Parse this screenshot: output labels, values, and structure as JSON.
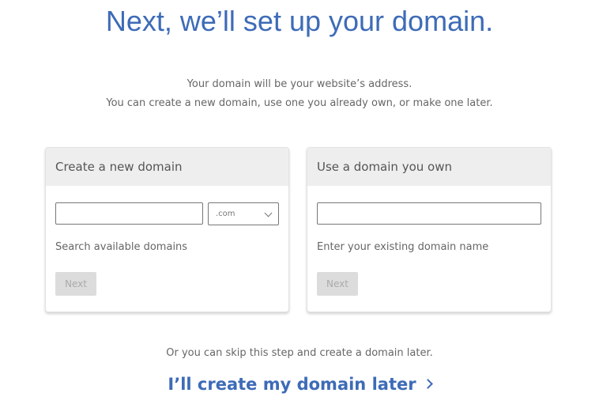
{
  "header": {
    "title": "Next, we’ll set up your domain.",
    "subtitle_line1": "Your domain will be your website’s address.",
    "subtitle_line2": "You can create a new domain, use one you already own, or make one later."
  },
  "cards": [
    {
      "title": "Create a new domain",
      "input_value": "",
      "tld_selected": ".com",
      "hint": "Search available domains",
      "button_label": "Next",
      "button_disabled": true
    },
    {
      "title": "Use a domain you own",
      "input_value": "",
      "hint": "Enter your existing domain name",
      "button_label": "Next",
      "button_disabled": true
    }
  ],
  "footer": {
    "skip_text": "Or you can skip this step and create a domain later.",
    "later_link": "I’ll create my domain later",
    "later_icon": "chevron-right-icon"
  },
  "colors": {
    "accent": "#3d6bb7",
    "card_header": "#eeeeee",
    "button_disabled": "#dcdcdc"
  }
}
